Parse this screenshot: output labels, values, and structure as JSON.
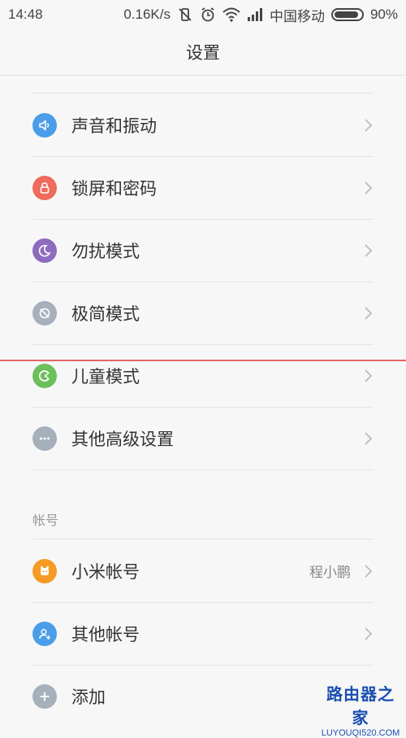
{
  "status_bar": {
    "time": "14:48",
    "speed": "0.16K/s",
    "carrier": "中国移动",
    "battery": "90%"
  },
  "header": {
    "title": "设置"
  },
  "items": [
    {
      "label": "声音和振动",
      "icon": "speaker-icon",
      "color": "#4a9de8"
    },
    {
      "label": "锁屏和密码",
      "icon": "lock-icon",
      "color": "#ef6b5c"
    },
    {
      "label": "勿扰模式",
      "icon": "moon-icon",
      "color": "#8e6bbf"
    },
    {
      "label": "极简模式",
      "icon": "no-entry-icon",
      "color": "#a6b0bb"
    },
    {
      "label": "儿童模式",
      "icon": "kids-icon",
      "color": "#6cc05b"
    },
    {
      "label": "其他高级设置",
      "icon": "more-icon",
      "color": "#a6b0bb"
    }
  ],
  "account_section": {
    "title": "帐号",
    "items": [
      {
        "label": "小米帐号",
        "value": "程小鹏",
        "icon": "mi-account-icon",
        "color": "#f59a23"
      },
      {
        "label": "其他帐号",
        "icon": "add-user-icon",
        "color": "#4a9de8"
      },
      {
        "label": "添加",
        "icon": "plus-icon",
        "color": "#a6b0bb"
      }
    ]
  },
  "watermark": {
    "top": "路由器之家",
    "bottom": "LUYOUQI520.COM"
  }
}
